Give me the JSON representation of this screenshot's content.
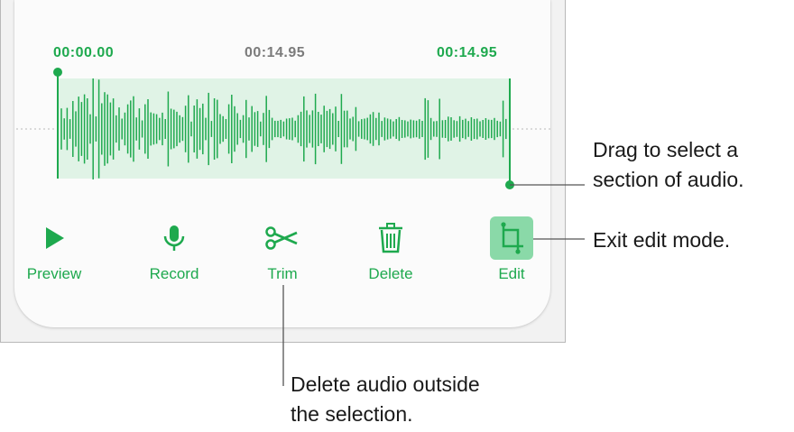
{
  "panel": {
    "time_start": "00:00.00",
    "time_current": "00:14.95",
    "time_end": "00:14.95"
  },
  "toolbar": {
    "preview_label": "Preview",
    "record_label": "Record",
    "trim_label": "Trim",
    "delete_label": "Delete",
    "edit_label": "Edit"
  },
  "icons": {
    "preview": "play-icon",
    "record": "microphone-icon",
    "trim": "scissors-icon",
    "delete": "trash-icon",
    "edit": "crop-icon"
  },
  "callouts": {
    "selection_line1": "Drag to select a",
    "selection_line2": "section of audio.",
    "edit": "Exit edit mode.",
    "trim_line1": "Delete audio outside",
    "trim_line2": "the selection."
  },
  "colors": {
    "accent": "#1ea94e",
    "selection_fill": "#e0f3e6",
    "edit_button_bg": "#8ad9a8",
    "time_gray": "#7b7b7b"
  }
}
